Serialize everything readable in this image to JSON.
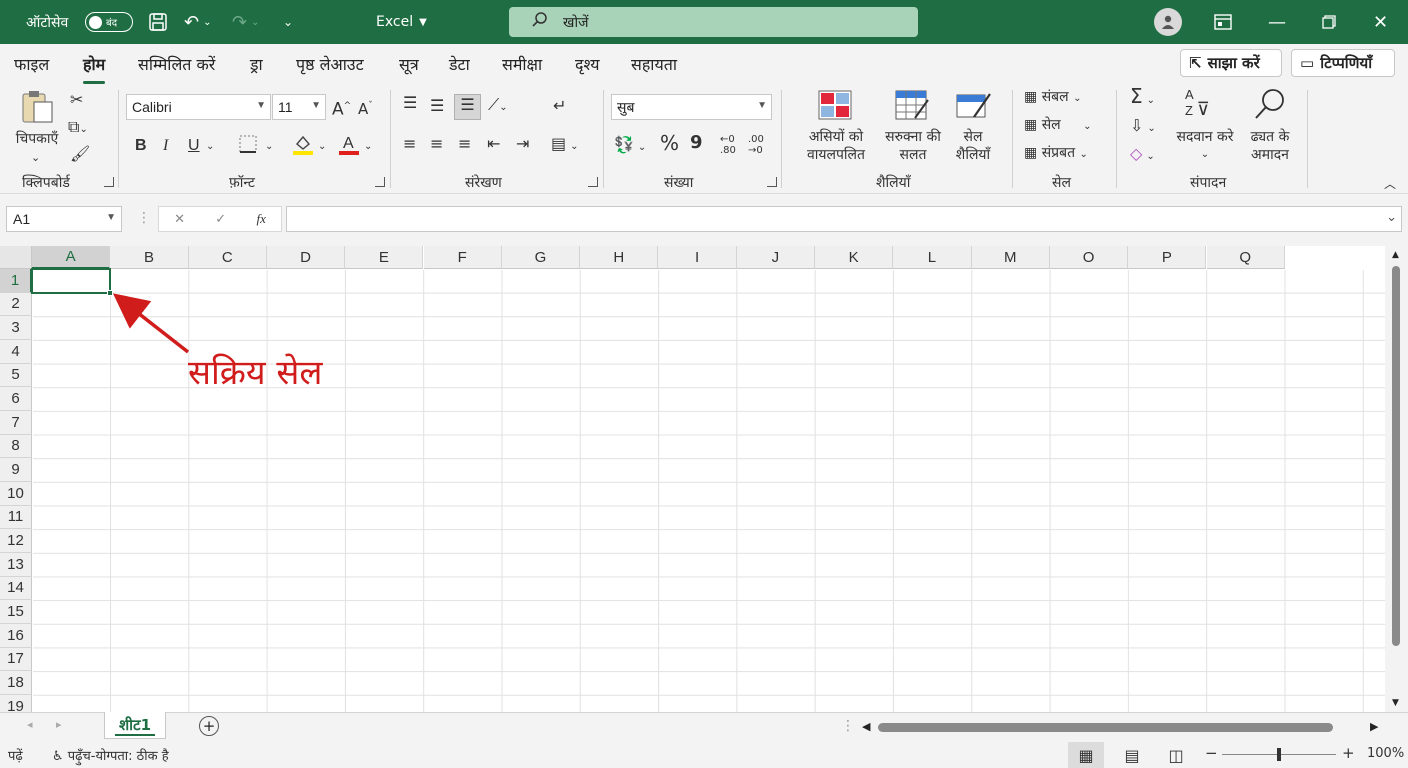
{
  "titlebar": {
    "autosave_label": "ऑटोसेव",
    "autosave_state": "बंद",
    "app_name": "Excel",
    "search_placeholder": "खोजें"
  },
  "menu": {
    "tabs": [
      "फाइल",
      "होम",
      "सम्मिलित करें",
      "ड्रा",
      "पृष्ठ लेआउट",
      "सूत्र",
      "डेटा",
      "समीक्षा",
      "दृश्य",
      "सहायता"
    ],
    "active_tab": "होम",
    "share_label": "साझा करें",
    "comments_label": "टिप्पणियाँ"
  },
  "ribbon": {
    "clipboard": {
      "paste_label": "चिपकाएँ",
      "group_label": "क्लिपबोर्ड"
    },
    "font": {
      "font_name": "Calibri",
      "font_size": "11",
      "bold": "B",
      "italic": "I",
      "underline": "U",
      "group_label": "फ़ॉन्ट"
    },
    "alignment": {
      "group_label": "संरेखण"
    },
    "number": {
      "format": "सुब",
      "percent": "%",
      "comma": "9",
      "group_label": "संख्या"
    },
    "styles": {
      "conditional_line1": "असियों को",
      "conditional_line2": "वायलपलित",
      "table_line1": "सरुक्ना की",
      "table_line2": "सलत",
      "cell_line1": "सेल",
      "cell_line2": "शैलियाँ",
      "group_label": "शैलियाँ"
    },
    "cells": {
      "insert": "संबल",
      "delete": "सेल",
      "format": "संप्रबत",
      "group_label": "सेल"
    },
    "editing": {
      "sort_label": "सदवान करे",
      "find_line1": "ढ्यत के",
      "find_line2": "अमादन",
      "sigma": "Σ",
      "group_label": "संपादन"
    }
  },
  "formula_bar": {
    "name_box": "A1",
    "fx": "fx",
    "value": ""
  },
  "grid": {
    "columns": [
      "A",
      "B",
      "C",
      "D",
      "E",
      "F",
      "G",
      "H",
      "I",
      "J",
      "K",
      "L",
      "M",
      "O",
      "P",
      "Q"
    ],
    "rows": [
      "1",
      "2",
      "3",
      "4",
      "5",
      "6",
      "7",
      "8",
      "9",
      "10",
      "11",
      "12",
      "13",
      "14",
      "15",
      "16",
      "17",
      "18",
      "19"
    ],
    "active_cell": "A1"
  },
  "annotation": {
    "text": "सक्रिय सेल",
    "color": "#d11c1c"
  },
  "sheets": {
    "tabs": [
      "शीट1"
    ],
    "active": "शीट1"
  },
  "status": {
    "mode": "पढ़ें",
    "accessibility": "पढ़ुँच-योग्पता: ठीक है",
    "zoom": "100%",
    "zoom_percent": 100
  },
  "colors": {
    "brand": "#1f6e43",
    "search_bg": "#a8d3b8"
  }
}
